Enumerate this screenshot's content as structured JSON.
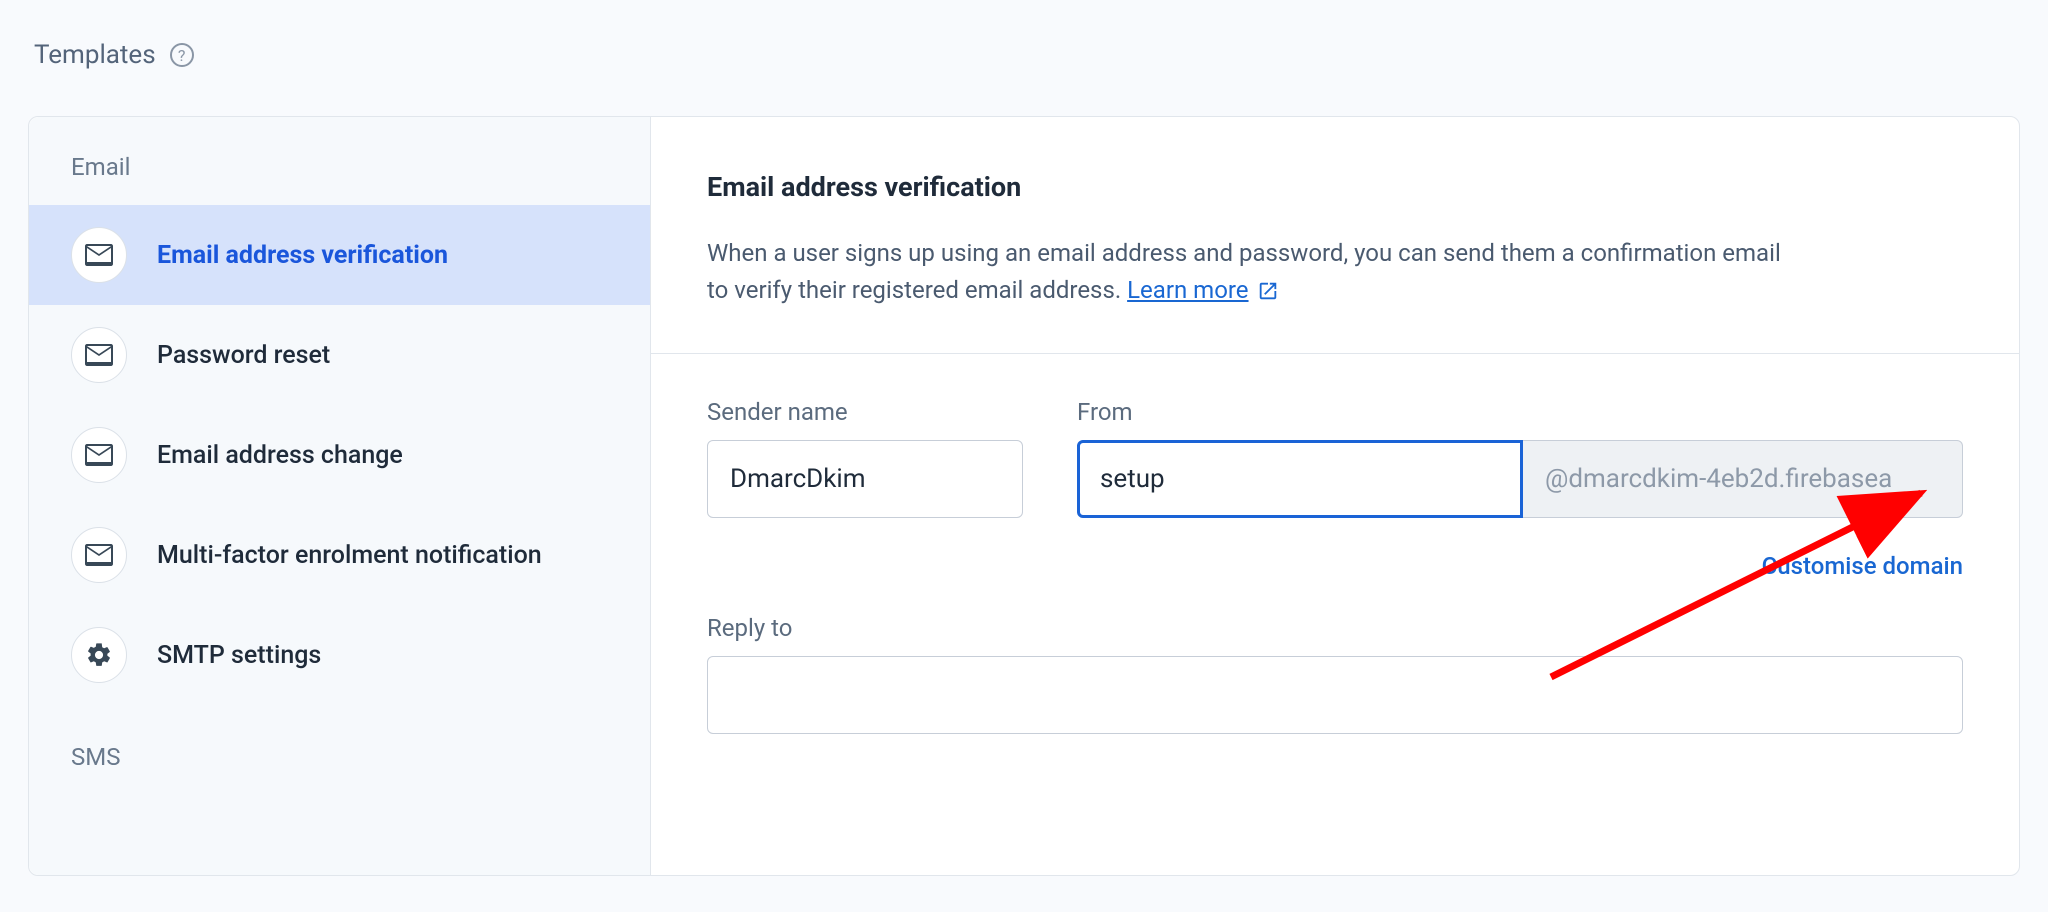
{
  "header": {
    "title": "Templates"
  },
  "sidebar": {
    "sections": {
      "email_label": "Email",
      "sms_label": "SMS"
    },
    "items": [
      {
        "label": "Email address verification"
      },
      {
        "label": "Password reset"
      },
      {
        "label": "Email address change"
      },
      {
        "label": "Multi-factor enrolment notification"
      },
      {
        "label": "SMTP settings"
      }
    ]
  },
  "main": {
    "title": "Email address verification",
    "description_line1": "When a user signs up using an email address and password, you can send them a confirmation email",
    "description_line2_prefix": "to verify their registered email address. ",
    "learn_more": "Learn more",
    "fields": {
      "sender_name_label": "Sender name",
      "sender_name_value": "DmarcDkim",
      "from_label": "From",
      "from_value": "setup",
      "from_domain": "@dmarcdkim-4eb2d.firebasea",
      "reply_to_label": "Reply to",
      "reply_to_value": ""
    },
    "customise_domain": "Customise domain"
  }
}
